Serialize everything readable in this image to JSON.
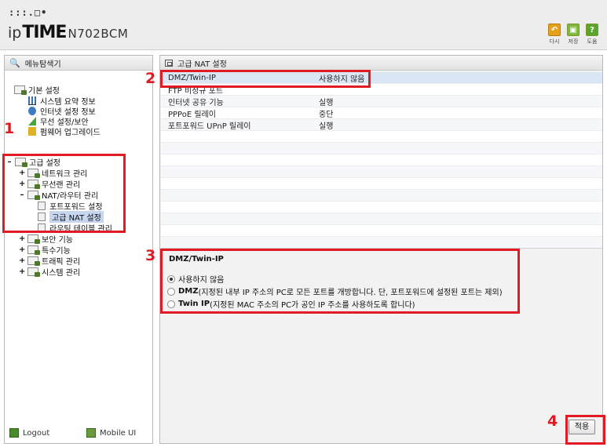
{
  "brand": {
    "dots": ":::.□•",
    "ip": "ip",
    "time": "TIME",
    "model": "N702BCM"
  },
  "toolbar": {
    "refresh_label": "다시",
    "save_label": "저장",
    "help_label": "도움"
  },
  "sidebar": {
    "title": "메뉴탐색기",
    "basic": {
      "label": "기본 설정",
      "items": [
        {
          "label": "시스템 요약 정보"
        },
        {
          "label": "인터넷 설정 정보"
        },
        {
          "label": "무선 설정/보안"
        },
        {
          "label": "펌웨어 업그레이드"
        }
      ]
    },
    "advanced": {
      "label": "고급 설정",
      "groups": [
        {
          "label": "네트워크 관리"
        },
        {
          "label": "무선랜 관리"
        },
        {
          "label": "NAT/라우터 관리"
        },
        {
          "label": "보안 기능"
        },
        {
          "label": "특수기능"
        },
        {
          "label": "트래픽 관리"
        },
        {
          "label": "시스템 관리"
        }
      ],
      "nat_children": [
        {
          "label": "포트포워드 설정"
        },
        {
          "label": "고급 NAT 설정"
        },
        {
          "label": "라우팅 테이블 관리"
        }
      ]
    },
    "footer": {
      "logout": "Logout",
      "mobile": "Mobile UI"
    }
  },
  "main": {
    "title": "고급 NAT 설정",
    "rows": [
      {
        "name": "DMZ/Twin-IP",
        "value": "사용하지 않음"
      },
      {
        "name": "FTP 비정규 포트",
        "value": ""
      },
      {
        "name": "인터넷 공유 기능",
        "value": "실행"
      },
      {
        "name": "PPPoE 릴레이",
        "value": "중단"
      },
      {
        "name": "포트포워드 UPnP 릴레이",
        "value": "실행"
      }
    ],
    "dmz": {
      "title": "DMZ/Twin-IP",
      "options": [
        {
          "strong": "",
          "text": "사용하지 않음",
          "selected": true
        },
        {
          "strong": "DMZ",
          "text": " (지정된 내부 IP 주소의 PC로 모든 포트를 개방합니다. 단, 포트포워드에 설정된 포트는 제외)",
          "selected": false
        },
        {
          "strong": "Twin IP",
          "text": " (지정된 MAC 주소의 PC가 공인 IP 주소를 사용하도록 합니다)",
          "selected": false
        }
      ]
    },
    "apply_label": "적용"
  },
  "annotations": {
    "n1": "1",
    "n2": "2",
    "n3": "3",
    "n4": "4",
    "color": "#e11b22"
  }
}
